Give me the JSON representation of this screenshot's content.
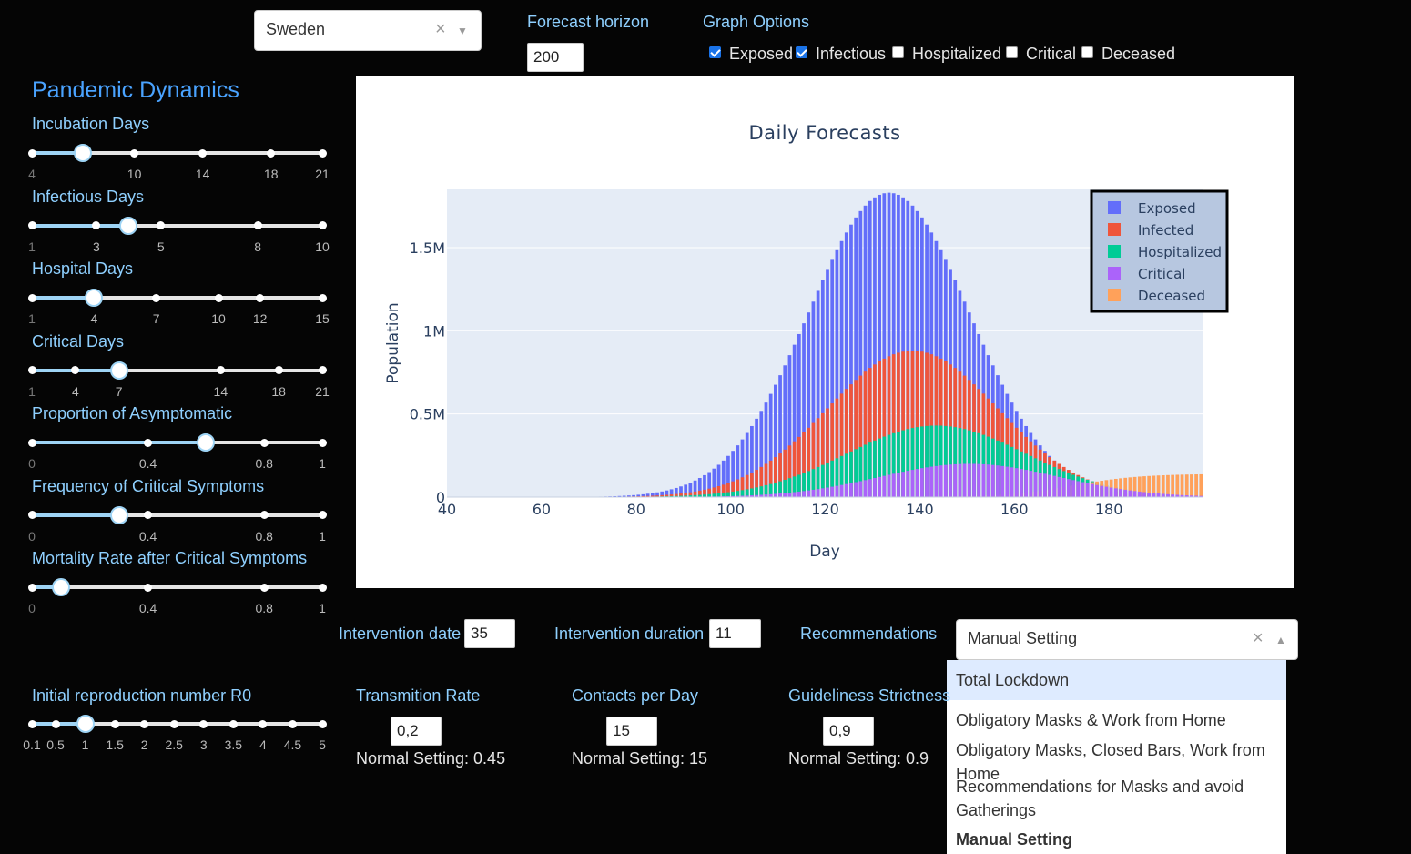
{
  "country_select": {
    "value": "Sweden"
  },
  "forecast_horizon": {
    "label": "Forecast horizon",
    "value": "200"
  },
  "graph_options": {
    "label": "Graph Options",
    "items": [
      {
        "label": "Exposed",
        "checked": true
      },
      {
        "label": "Infectious",
        "checked": true
      },
      {
        "label": "Hospitalized",
        "checked": false
      },
      {
        "label": "Critical",
        "checked": false
      },
      {
        "label": "Deceased",
        "checked": false
      }
    ]
  },
  "section_title": "Pandemic Dynamics",
  "sliders": [
    {
      "title": "Incubation Days",
      "ticks": [
        "4",
        "10",
        "14",
        "18",
        "21"
      ],
      "value": 7
    },
    {
      "title": "Infectious Days",
      "ticks": [
        "1",
        "3",
        "5",
        "8",
        "10"
      ],
      "value": 4
    },
    {
      "title": "Hospital Days",
      "ticks": [
        "1",
        "4",
        "7",
        "10",
        "12",
        "15"
      ],
      "value": 4
    },
    {
      "title": "Critical Days",
      "ticks": [
        "1",
        "4",
        "7",
        "14",
        "18",
        "21"
      ],
      "value": 7
    },
    {
      "title": "Proportion of Asymptomatic",
      "ticks": [
        "0",
        "0.4",
        "0.8",
        "1"
      ],
      "value": 0.6
    },
    {
      "title": "Frequency of Critical Symptoms",
      "ticks": [
        "0",
        "0.4",
        "0.8",
        "1"
      ],
      "value": 0.3
    },
    {
      "title": "Mortality Rate after Critical Symptoms",
      "ticks": [
        "0",
        "0.4",
        "0.8",
        "1"
      ],
      "value": 0.1
    }
  ],
  "r0_slider": {
    "title": "Initial reproduction number R0",
    "ticks": [
      "0.1",
      "0.5",
      "1",
      "1.5",
      "2",
      "2.5",
      "3",
      "3.5",
      "4",
      "4.5",
      "5"
    ],
    "value": 1
  },
  "intervention": {
    "date_label": "Intervention date",
    "date_value": "35",
    "duration_label": "Intervention duration",
    "duration_value": "11",
    "recommendations_label": "Recommendations"
  },
  "recommendations_select": {
    "value": "Manual Setting",
    "options": [
      "Total Lockdown",
      "Obligatory Masks & Work from Home",
      "Obligatory Masks, Closed Bars, Work from Home",
      "Recommendations for Masks and avoid Gatherings",
      "Manual Setting"
    ]
  },
  "params": [
    {
      "label": "Transmition Rate",
      "value": "0,2",
      "normal": "Normal Setting: 0.45"
    },
    {
      "label": "Contacts per Day",
      "value": "15",
      "normal": "Normal Setting: 15"
    },
    {
      "label": "Guideliness Strictness",
      "value": "0,9",
      "normal": "Normal Setting: 0.9"
    }
  ],
  "chart_data": {
    "type": "bar",
    "title": "Daily Forecasts",
    "xlabel": "Day",
    "ylabel": "Population",
    "xlim": [
      40,
      200
    ],
    "ylim": [
      0,
      1850000
    ],
    "x_ticks": [
      "40",
      "60",
      "80",
      "100",
      "120",
      "140",
      "160",
      "180"
    ],
    "y_ticks": [
      "0",
      "0.5M",
      "1M",
      "1.5M"
    ],
    "legend_position": "top-right",
    "series": [
      {
        "name": "Exposed",
        "color": "#636efa",
        "peak_day": 133,
        "peak": 1830000,
        "width": 17
      },
      {
        "name": "Infected",
        "color": "#ef553b",
        "peak_day": 138,
        "peak": 880000,
        "width": 18
      },
      {
        "name": "Hospitalized",
        "color": "#00cc96",
        "peak_day": 143,
        "peak": 430000,
        "width": 19
      },
      {
        "name": "Critical",
        "color": "#ab63fa",
        "peak_day": 150,
        "peak": 200000,
        "width": 19
      },
      {
        "name": "Deceased",
        "color": "#ffa15a",
        "final": 140000,
        "mid_day": 172,
        "scale": 7
      }
    ]
  }
}
